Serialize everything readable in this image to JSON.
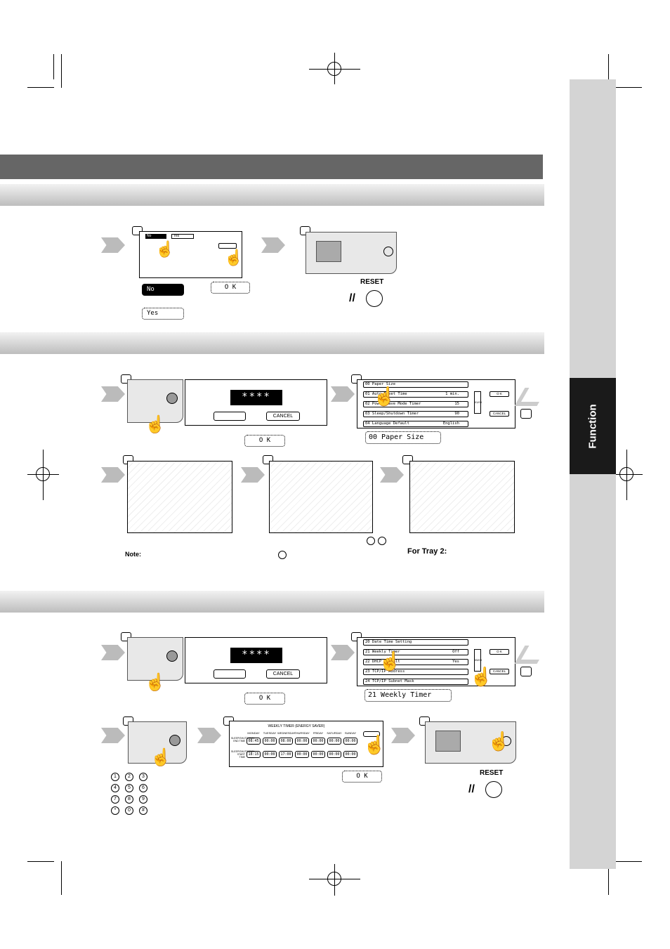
{
  "side_tab": {
    "label": "Function"
  },
  "section1": {
    "no_button": "No",
    "yes_button": "Yes",
    "ok_button": "O K",
    "reset_label": "RESET",
    "mini_no": "No",
    "mini_yes": "Yes"
  },
  "section2": {
    "password_mask": "****",
    "ok_button": "O K",
    "cancel_button": "CANCEL",
    "settings_rows": [
      {
        "label": "00  Paper Size",
        "value": ""
      },
      {
        "label": "01  Auto Reset Time",
        "value": "1 min."
      },
      {
        "label": "02  Power Save Mode Timer",
        "value": "15"
      },
      {
        "label": "03  Sleep/Shutdown Timer",
        "value": "90"
      },
      {
        "label": "04  Language Default",
        "value": "English"
      }
    ],
    "page_indicator": "01/09",
    "selected_label": "00  Paper Size",
    "note_label": "Note:",
    "tray2_label": "For Tray 2:"
  },
  "section3": {
    "password_mask": "****",
    "ok_button": "O K",
    "cancel_button": "CANCEL",
    "settings_rows": [
      {
        "label": "20  Date Time Setting",
        "value": ""
      },
      {
        "label": "21  Weekly Timer",
        "value": "Off"
      },
      {
        "label": "22  DHCP Default",
        "value": "Yes"
      },
      {
        "label": "23  TCP/IP Address",
        "value": ""
      },
      {
        "label": "24  TCP/IP Subnet Mask",
        "value": ""
      }
    ],
    "page_indicator": "05/09",
    "selected_label": "21  Weekly Timer",
    "weekly_timer": {
      "title": "WEEKLY TIMER (ENERGY SAVER)",
      "row1_label": "SLEEP/SHUTDOWN END TIME",
      "row2_label": "SLEEP/SHUTDOWN START TIME",
      "days": [
        "MONDAY",
        "TUESDAY",
        "WEDNESDAY",
        "THURSDAY",
        "FRIDAY",
        "SATURDAY",
        "SUNDAY"
      ],
      "end_times": [
        "08:45",
        "00:00",
        "08:00",
        "00:00",
        "00:00",
        "00:00",
        "00:00"
      ],
      "start_times": [
        "18:15",
        "00:00",
        "17:00",
        "00:00",
        "00:00",
        "00:00",
        "00:00"
      ]
    },
    "keypad": [
      "1",
      "2",
      "3",
      "4",
      "5",
      "6",
      "7",
      "8",
      "9",
      "*",
      "0",
      "#"
    ],
    "reset_label": "RESET"
  }
}
